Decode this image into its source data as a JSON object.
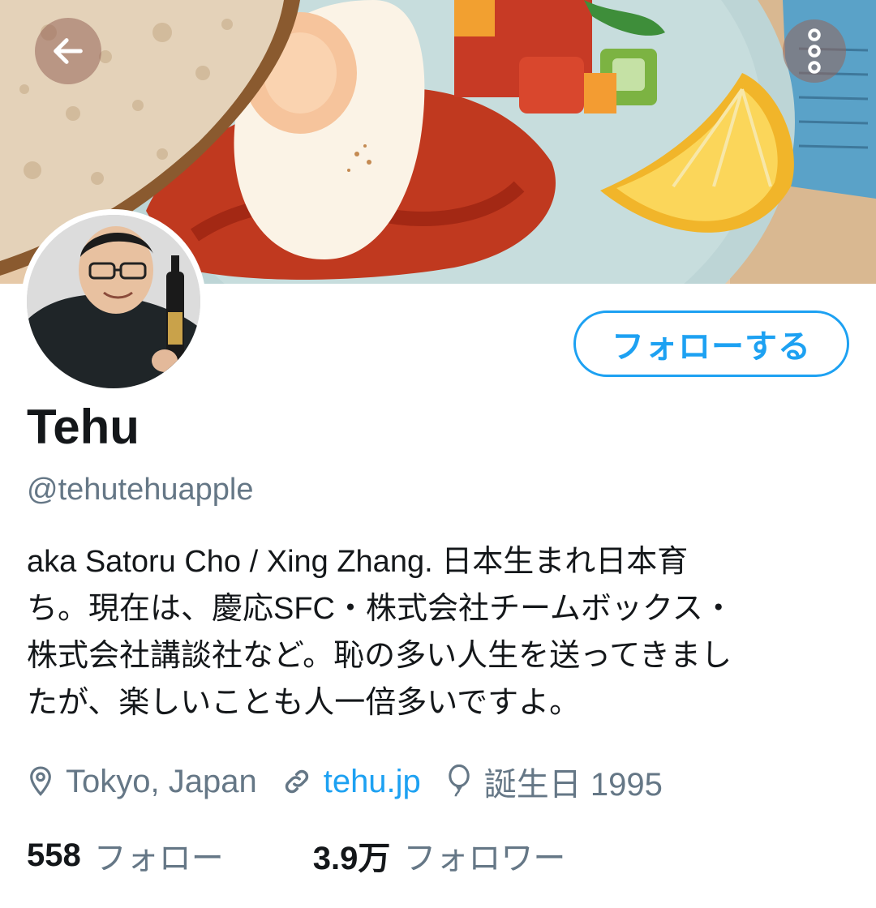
{
  "profile": {
    "name": "Tehu",
    "handle": "@tehutehuapple",
    "bio": "aka Satoru Cho / Xing Zhang. 日本生まれ日本育ち。現在は、慶応SFC・株式会社チームボックス・株式会社講談社など。恥の多い人生を送ってきましたが、楽しいことも人一倍多いですよ。",
    "bio_lines": [
      "aka Satoru Cho / Xing Zhang. 日本生まれ日本育",
      "ち。現在は、慶応SFC・株式会社チームボックス・",
      "株式会社講談社など。恥の多い人生を送ってきまし",
      "たが、楽しいことも人一倍多いですよ。"
    ]
  },
  "actions": {
    "follow_label": "フォローする"
  },
  "meta": {
    "location": "Tokyo, Japan",
    "website": "tehu.jp",
    "birthday": "誕生日 1995"
  },
  "stats": {
    "following_count": "558",
    "following_label": "フォロー",
    "followers_count": "3.9万",
    "followers_label": "フォロワー"
  },
  "icons": {
    "back": "arrow-left-icon",
    "more": "more-vertical-icon",
    "location": "map-pin-icon",
    "link": "link-icon",
    "birthday": "balloon-icon"
  },
  "colors": {
    "accent": "#1da1f2",
    "text_primary": "#14171a",
    "text_secondary": "#657786"
  }
}
